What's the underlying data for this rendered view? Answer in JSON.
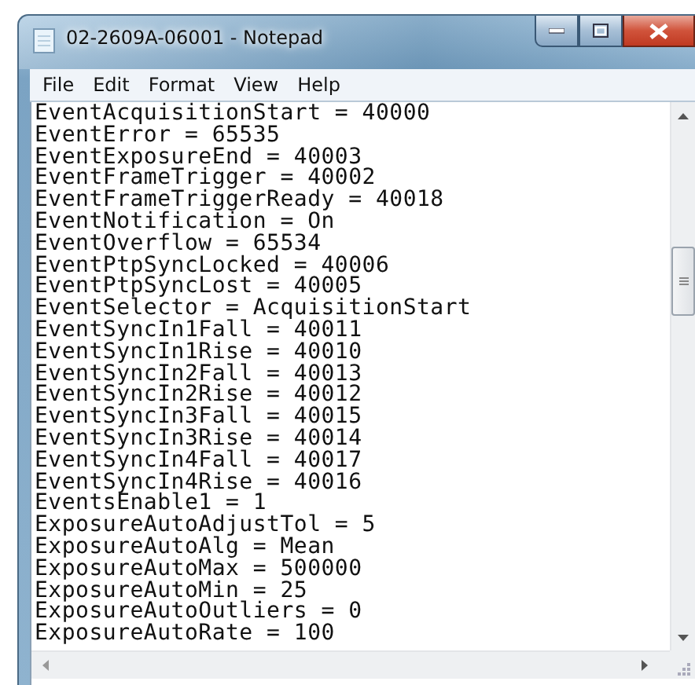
{
  "window": {
    "title": "02-2609A-06001 - Notepad"
  },
  "menu": [
    "File",
    "Edit",
    "Format",
    "View",
    "Help"
  ],
  "lines": [
    "EventAcquisitionStart = 40000",
    "EventError = 65535",
    "EventExposureEnd = 40003",
    "EventFrameTrigger = 40002",
    "EventFrameTriggerReady = 40018",
    "EventNotification = On",
    "EventOverflow = 65534",
    "EventPtpSyncLocked = 40006",
    "EventPtpSyncLost = 40005",
    "EventSelector = AcquisitionStart",
    "EventSyncIn1Fall = 40011",
    "EventSyncIn1Rise = 40010",
    "EventSyncIn2Fall = 40013",
    "EventSyncIn2Rise = 40012",
    "EventSyncIn3Fall = 40015",
    "EventSyncIn3Rise = 40014",
    "EventSyncIn4Fall = 40017",
    "EventSyncIn4Rise = 40016",
    "EventsEnable1 = 1",
    "ExposureAutoAdjustTol = 5",
    "ExposureAutoAlg = Mean",
    "ExposureAutoMax = 500000",
    "ExposureAutoMin = 25",
    "ExposureAutoOutliers = 0",
    "ExposureAutoRate = 100"
  ]
}
